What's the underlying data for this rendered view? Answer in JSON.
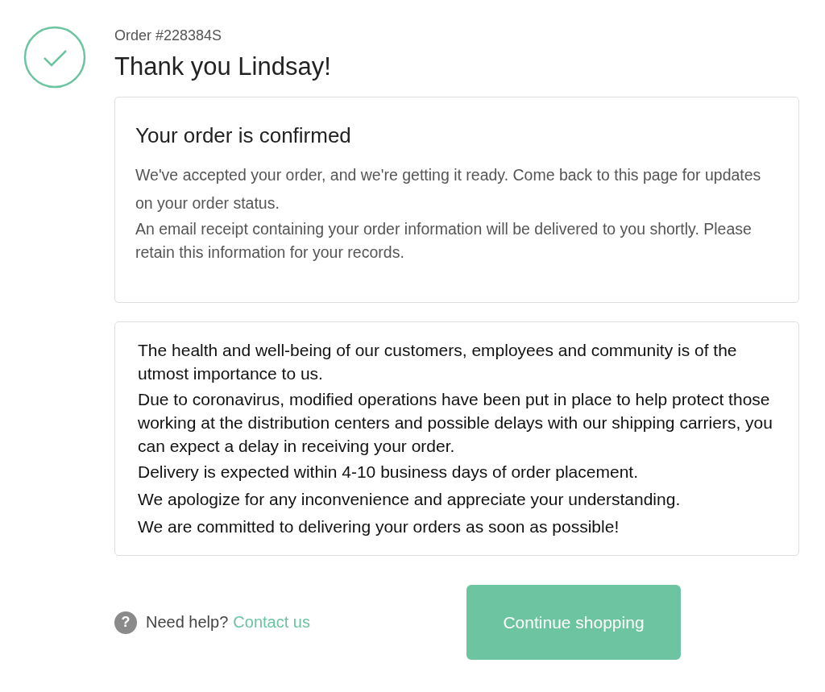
{
  "order_number": "Order #228384S",
  "title": "Thank you Lindsay!",
  "confirmation": {
    "heading": "Your order is confirmed",
    "paragraphs": [
      "We've accepted your order, and we're getting it ready. Come back to this page for updates on your order status.",
      "An email receipt containing your order information will be delivered to you shortly. Please retain this information for your records."
    ]
  },
  "notice": {
    "paragraphs": [
      "The health and well-being of our customers, employees and community is of the utmost importance to us.",
      "Due to coronavirus, modified operations have been put in place to help protect those working at the distribution centers and possible delays with our shipping carriers, you can expect a delay in receiving your order.",
      "Delivery is expected within 4-10 business days of order placement.",
      "We apologize for any inconvenience and appreciate your understanding.",
      "We are committed to delivering your orders as soon as possible!"
    ]
  },
  "help": {
    "icon": "?",
    "text": "Need help?",
    "link": "Contact us"
  },
  "button": "Continue shopping"
}
